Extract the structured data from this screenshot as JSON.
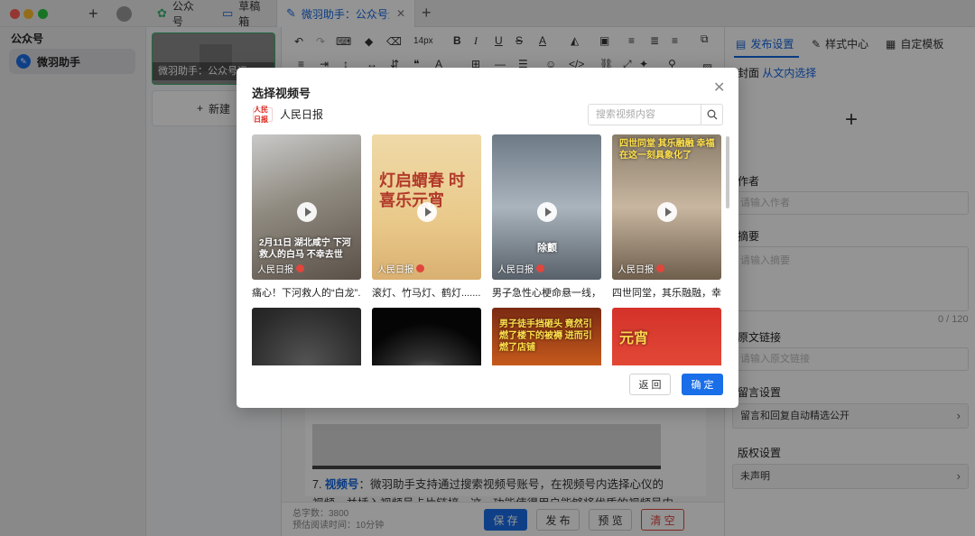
{
  "window": {
    "tabs": [
      {
        "label": "公众号"
      },
      {
        "label": "草稿箱"
      },
      {
        "label": "微羽助手：公众号运..."
      }
    ]
  },
  "sidebar": {
    "section_title": "公众号",
    "items": [
      {
        "label": "微羽助手"
      }
    ]
  },
  "drafts": {
    "card_caption": "微羽助手：公众号运",
    "new_label": "新建"
  },
  "editor": {
    "font_size": "14px",
    "paragraph": {
      "number": "7.",
      "keyword": "视频号",
      "text": "：微羽助手支持通过搜索视频号账号，在视频号内选择心仪的视频，并插入视频号卡片链接。这一功能使得用户能够将优质的视频号内容引入到自己的公众号文章中，丰富了文章的内容来源，同时也为视频号和公众号之间的流量互通提供"
    },
    "footer": {
      "word_count": "总字数：3800",
      "read_time": "预估阅读时间：10分钟",
      "save": "保 存",
      "publish": "发 布",
      "preview": "预 览",
      "clear": "清 空"
    }
  },
  "right_panel": {
    "tabs": [
      {
        "label": "发布设置"
      },
      {
        "label": "样式中心"
      },
      {
        "label": "自定模板"
      }
    ],
    "cover_label": "封面",
    "cover_link": "从文内选择",
    "author_label": "作者",
    "author_placeholder": "请输入作者",
    "summary_label": "摘要",
    "summary_placeholder": "请输入摘要",
    "summary_counter": "0 / 120",
    "source_label": "原文链接",
    "source_placeholder": "请输入原文链接",
    "comment_label": "留言设置",
    "comment_value": "留言和回复自动精选公开",
    "copyright_label": "版权设置",
    "copyright_value": "未声明"
  },
  "modal": {
    "title": "选择视频号",
    "account_name": "人民日报",
    "account_logo_text": "人民日报",
    "search_placeholder": "搜索视频内容",
    "videos": [
      {
        "title": "痛心！下河救人的“白龙”...",
        "watermark": "人民日报",
        "overlay": "2月11日 湖北咸宁 下河救人的白马 不幸去世"
      },
      {
        "title": "滚灯、竹马灯、鹤灯........",
        "watermark": "人民日报",
        "overlay": "灯启蝟春 时喜乐元宵"
      },
      {
        "title": "男子急性心梗命悬一线，...",
        "watermark": "人民日报",
        "overlay": "除颤"
      },
      {
        "title": "四世同堂，其乐融融，幸...",
        "watermark": "人民日报",
        "overlay": "四世同堂 其乐融融 幸福在这一刻具象化了"
      },
      {
        "title": "",
        "watermark": "",
        "overlay": ""
      },
      {
        "title": "",
        "watermark": "",
        "overlay": ""
      },
      {
        "title": "",
        "watermark": "",
        "overlay": "男子徒手挡砸头 竟然引燃了楼下的被褥 进而引燃了店铺"
      },
      {
        "title": "",
        "watermark": "",
        "overlay": "元宵"
      }
    ],
    "back_label": "返 回",
    "confirm_label": "确 定"
  }
}
